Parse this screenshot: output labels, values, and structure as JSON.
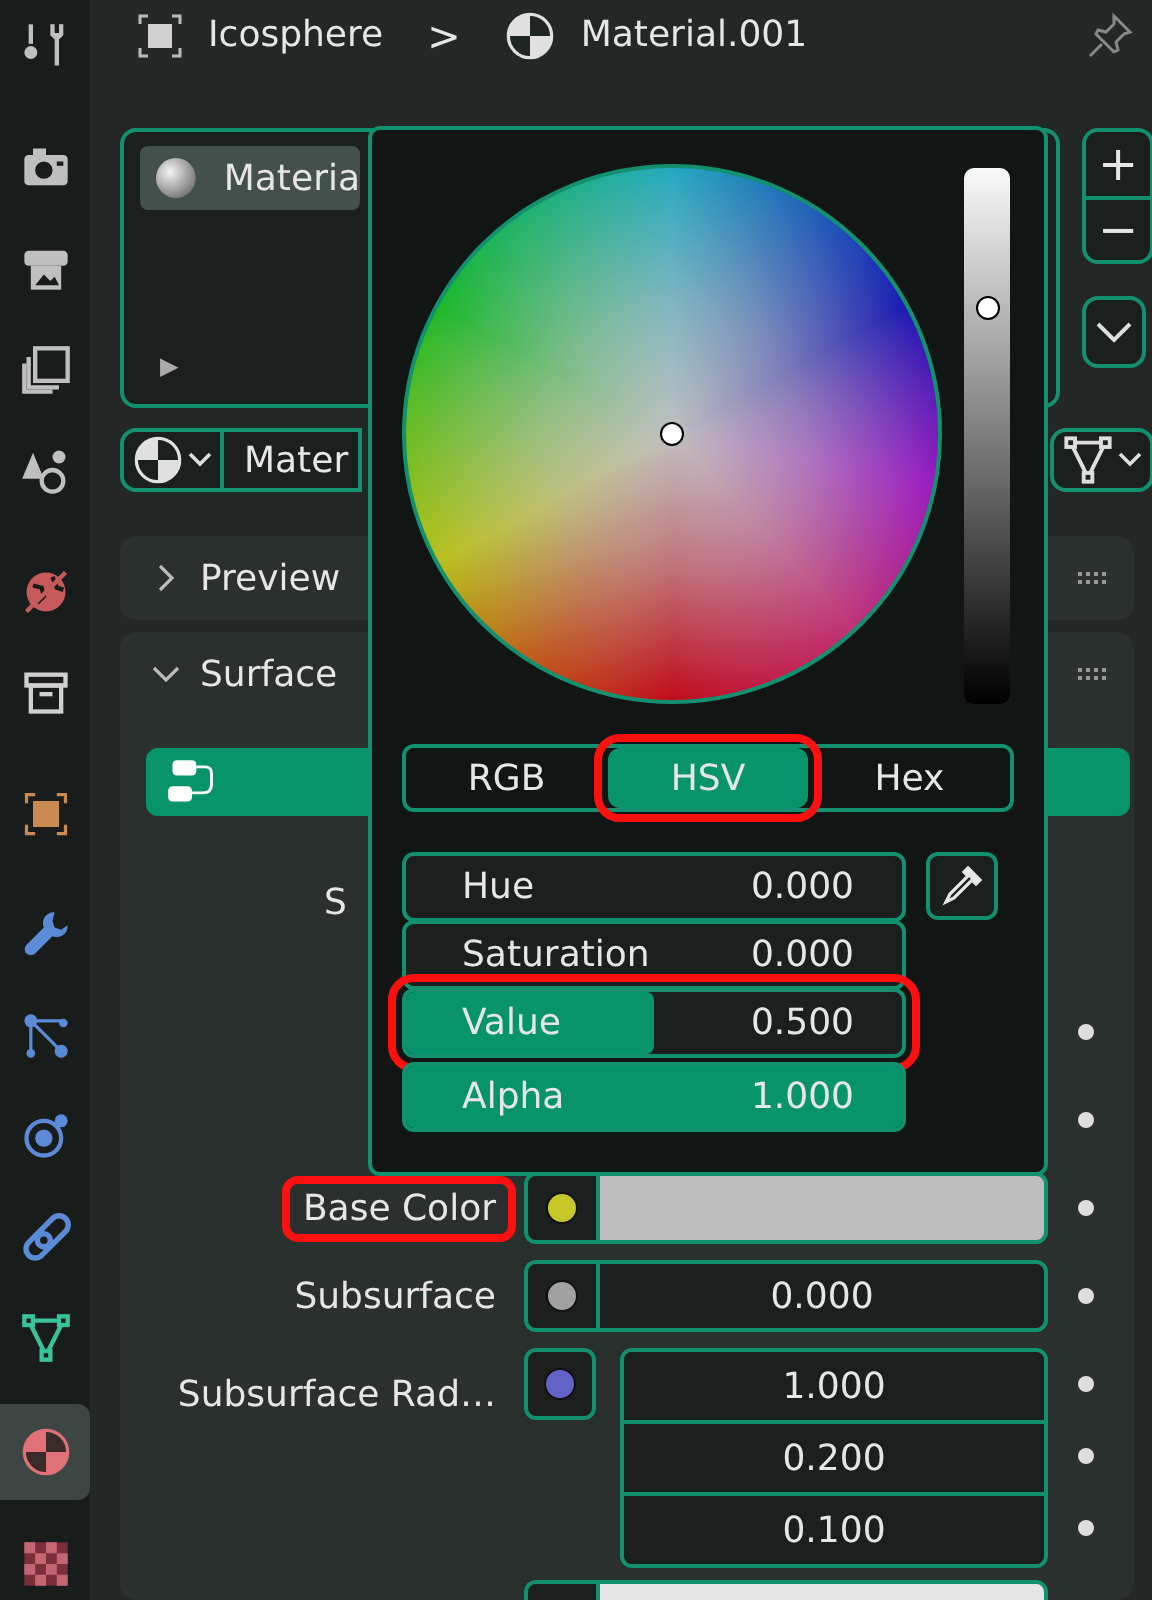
{
  "header": {
    "object": "Icosphere",
    "separator": ">",
    "material": "Material.001"
  },
  "sidebar": {
    "tabs": [
      {
        "kind": "tool",
        "selected": false
      },
      {
        "kind": "render",
        "selected": false
      },
      {
        "kind": "output",
        "selected": false
      },
      {
        "kind": "view_layer",
        "selected": false
      },
      {
        "kind": "scene",
        "selected": false
      },
      {
        "kind": "world",
        "selected": false
      },
      {
        "kind": "collection",
        "selected": false
      },
      {
        "kind": "object",
        "selected": false
      },
      {
        "kind": "modifiers",
        "selected": false
      },
      {
        "kind": "particles",
        "selected": false
      },
      {
        "kind": "physics",
        "selected": false
      },
      {
        "kind": "constraints",
        "selected": false
      },
      {
        "kind": "data",
        "selected": false
      },
      {
        "kind": "material",
        "selected": true
      },
      {
        "kind": "texture",
        "selected": false
      }
    ]
  },
  "material_slots": {
    "items": [
      {
        "name": "Materia",
        "selected": true
      }
    ],
    "expand": "▶",
    "add": "+",
    "remove": "−"
  },
  "selector": {
    "name": "Mater"
  },
  "panels": [
    {
      "title": "Preview",
      "expanded": false
    },
    {
      "title": "Surface",
      "expanded": true
    }
  ],
  "surface": {
    "rows": [
      {
        "kind": "label",
        "label": "S"
      },
      {
        "kind": "blank"
      },
      {
        "kind": "blank"
      },
      {
        "kind": "color",
        "label": "Base Color",
        "color": "#c7c729",
        "annotated": true
      },
      {
        "kind": "value",
        "label": "Subsurface",
        "color": "#a1a1a1",
        "value": "0.000",
        "annotated": false
      },
      {
        "kind": "vector",
        "label": "Subsurface Rad…",
        "color": "#6363c7",
        "values": [
          "1.000",
          "0.200",
          "0.100"
        ],
        "annotated": false
      }
    ]
  },
  "color_picker": {
    "brightness": {
      "level": 0.74
    },
    "tabs": [
      {
        "label": "RGB",
        "selected": false,
        "annotated": false
      },
      {
        "label": "HSV",
        "selected": true,
        "annotated": true
      },
      {
        "label": "Hex",
        "selected": false,
        "annotated": false
      }
    ],
    "fields": [
      {
        "label": "Hue",
        "value": "0.000",
        "annotated": false
      },
      {
        "label": "Saturation",
        "value": "0.000",
        "annotated": false
      },
      {
        "label": "Value",
        "value": "0.500",
        "level": 0.5,
        "annotated": true
      },
      {
        "label": "Alpha",
        "value": "1.000",
        "level": 1,
        "annotated": false
      }
    ]
  }
}
